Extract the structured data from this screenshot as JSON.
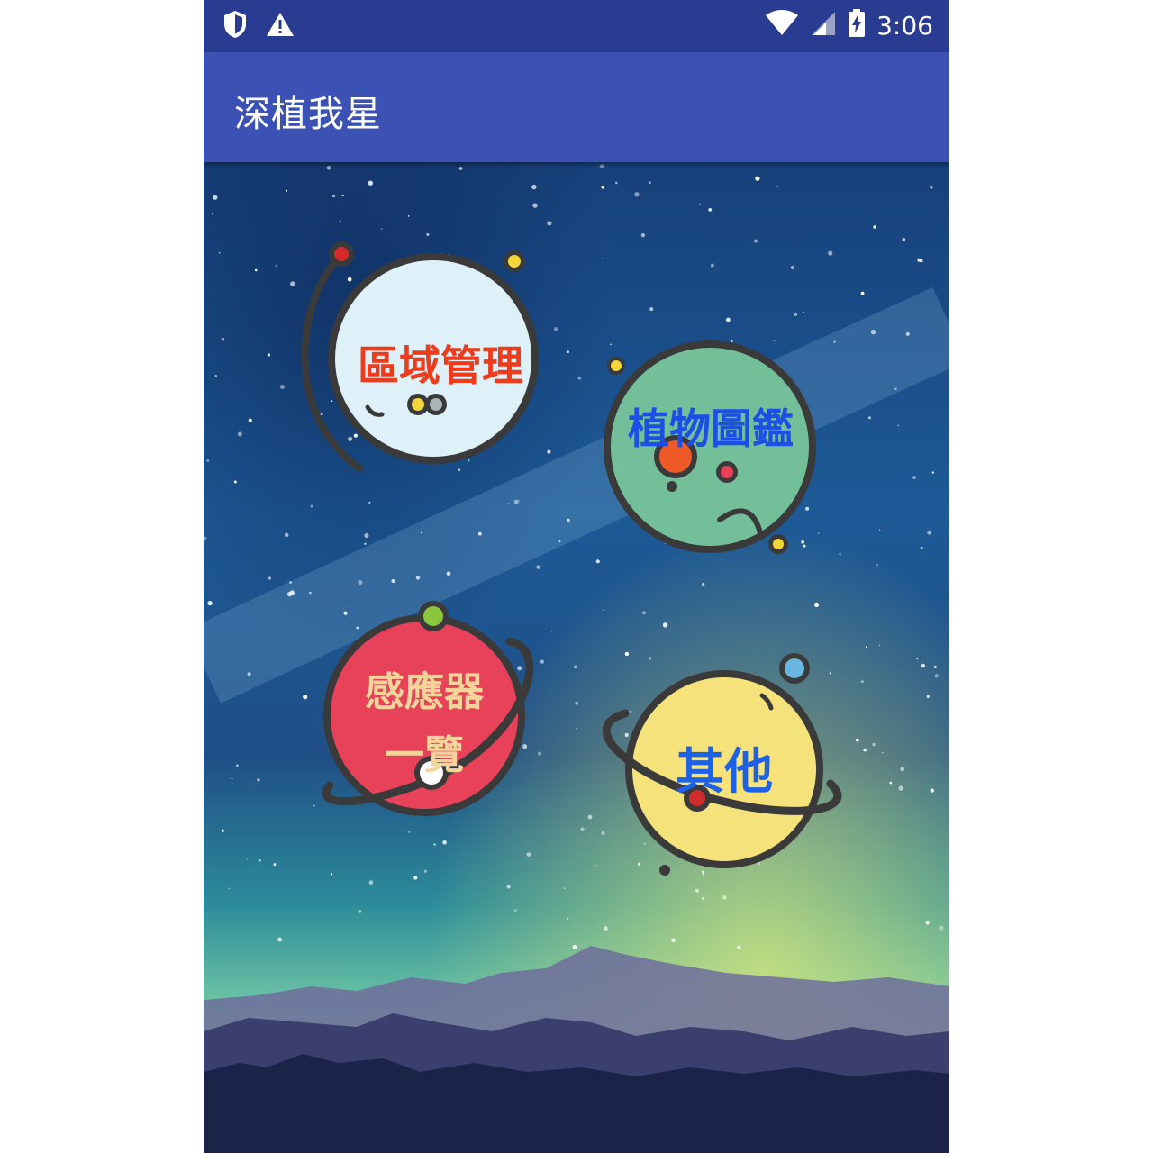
{
  "status_bar": {
    "time": "3:06",
    "icons": [
      "shield-icon",
      "warning-icon",
      "wifi-icon",
      "signal-icon",
      "battery-charging-icon"
    ]
  },
  "app_bar": {
    "title": "深植我星",
    "color": "#3b51b4"
  },
  "menu": {
    "area_management": {
      "label": "區域管理",
      "planet_color": "#dff1f8",
      "text_color": "#ee3b1c"
    },
    "plant_guide": {
      "label": "植物圖鑑",
      "planet_color": "#73bf9a",
      "text_color": "#1d4ee6"
    },
    "sensor_overview": {
      "label_line1": "感應器",
      "label_line2": "一覽",
      "planet_color": "#e8425a",
      "text_color": "#f3d59a"
    },
    "other": {
      "label": "其他",
      "planet_color": "#f6e27a",
      "text_color": "#1d62e6"
    }
  }
}
